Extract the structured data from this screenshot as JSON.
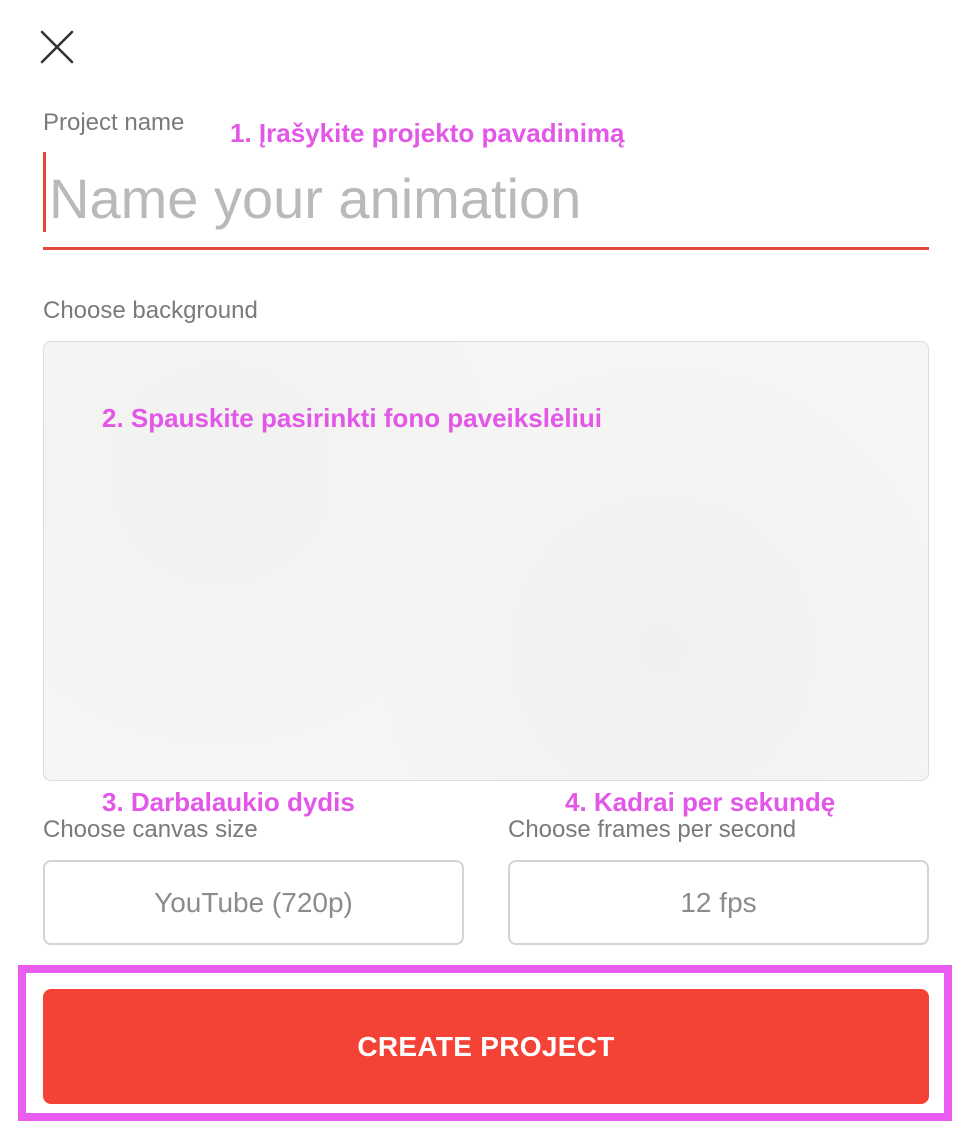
{
  "dialog": {
    "close_icon": "close-icon"
  },
  "project_name": {
    "label": "Project name",
    "placeholder": "Name your animation",
    "value": ""
  },
  "background": {
    "label": "Choose background"
  },
  "canvas_size": {
    "label": "Choose canvas size",
    "value": "YouTube (720p)"
  },
  "fps": {
    "label": "Choose frames per second",
    "value": "12 fps"
  },
  "create_button": {
    "label": "CREATE PROJECT"
  },
  "annotations": {
    "step1": "1. Įrašykite projekto pavadinimą",
    "step2": "2. Spauskite pasirinkti fono paveikslėliui",
    "step3": "3. Darbalaukio dydis",
    "step4": "4. Kadrai per sekundę"
  },
  "colors": {
    "accent": "#f44336",
    "annotation": "#e357e8",
    "highlight_frame": "#ea5cf0"
  }
}
